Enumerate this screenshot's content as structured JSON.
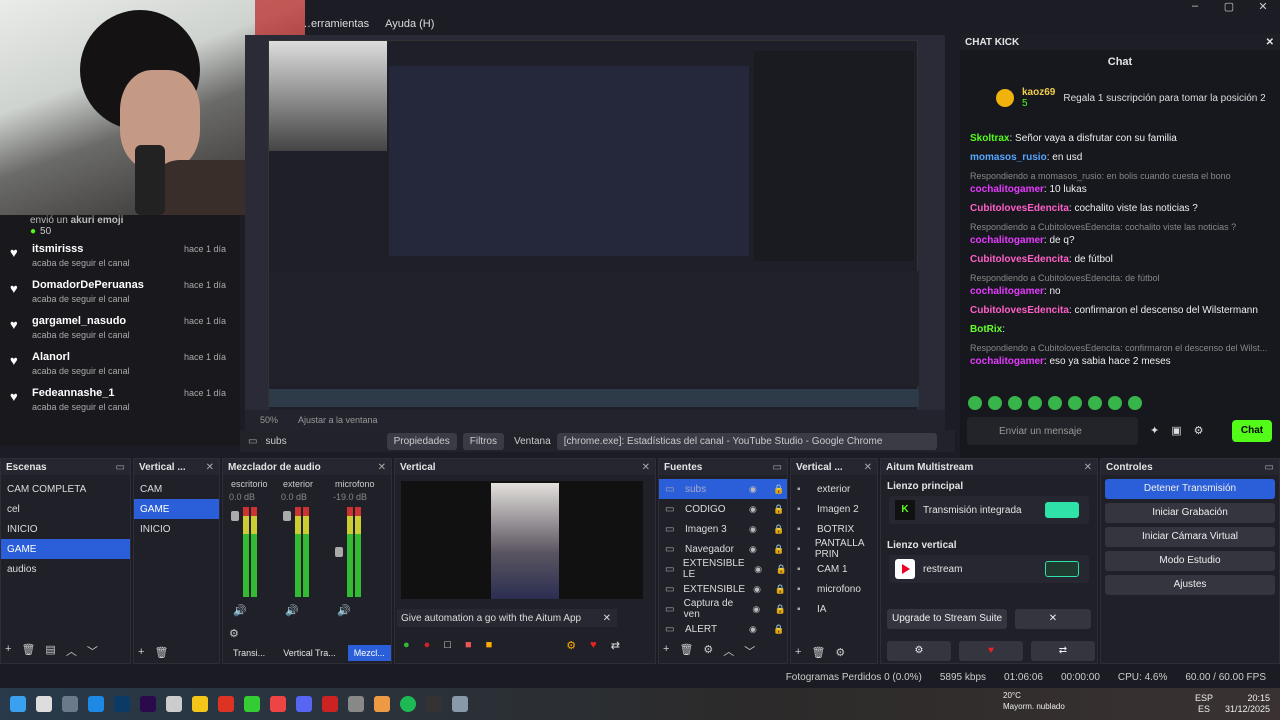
{
  "menu": [
    "…erramientas",
    "Ayuda (H)"
  ],
  "window_controls": [
    "–",
    "▢",
    "✕"
  ],
  "alerts": {
    "first_line": "envió un",
    "first_user": "akuri emoji",
    "points": "50",
    "items": [
      {
        "name": "itsmirisss",
        "action": "acaba de seguir el canal",
        "time": "hace 1 día"
      },
      {
        "name": "DomadorDePeruanas",
        "action": "acaba de seguir el canal",
        "time": "hace 1 día"
      },
      {
        "name": "gargamel_nasudo",
        "action": "acaba de seguir el canal",
        "time": "hace 1 día"
      },
      {
        "name": "Alanorl",
        "action": "acaba de seguir el canal",
        "time": "hace 1 día"
      },
      {
        "name": "Fedeannashe_1",
        "action": "acaba de seguir el canal",
        "time": "hace 1 día"
      }
    ]
  },
  "preview": {
    "zoom": "50%",
    "fit": "Ajustar a la ventana"
  },
  "chat": {
    "dock_title": "CHAT KICK",
    "title": "Chat",
    "pinned_user": "kaoz69",
    "pinned_count": "5",
    "pinned_text": "Regala 1 suscripción para tomar la posición 2",
    "messages": [
      {
        "type": "msg",
        "user": "Skoltrax",
        "ucls": "u1",
        "text": ": Señor vaya a disfrutar con su familia"
      },
      {
        "type": "msg",
        "user": "momasos_rusio",
        "ucls": "u2",
        "text": ": en usd"
      },
      {
        "type": "reply",
        "text": "Respondiendo a momasos_rusio: en bolis cuando cuesta el bono"
      },
      {
        "type": "msg",
        "user": "cochalitogamer",
        "ucls": "u3",
        "text": ": 10 lukas"
      },
      {
        "type": "msg",
        "user": "CubitolovesEdencita",
        "ucls": "u4",
        "text": ": cochalito viste las noticias ?"
      },
      {
        "type": "reply",
        "text": "Respondiendo a CubitolovesEdencita: cochalito viste las noticias ?"
      },
      {
        "type": "msg",
        "user": "cochalitogamer",
        "ucls": "u3",
        "text": ": de q?"
      },
      {
        "type": "msg",
        "user": "CubitolovesEdencita",
        "ucls": "u4",
        "text": ": de fútbol"
      },
      {
        "type": "reply",
        "text": "Respondiendo a CubitolovesEdencita: de fútbol"
      },
      {
        "type": "msg",
        "user": "cochalitogamer",
        "ucls": "u3",
        "text": ": no"
      },
      {
        "type": "msg",
        "user": "CubitolovesEdencita",
        "ucls": "u4",
        "text": ": confirmaron el descenso del Wilstermann"
      },
      {
        "type": "msg",
        "user": "BotRix",
        "ucls": "u5",
        "text": ":"
      },
      {
        "type": "reply",
        "text": "Respondiendo a CubitolovesEdencita: confirmaron el descenso del Wilst..."
      },
      {
        "type": "msg",
        "user": "cochalitogamer",
        "ucls": "u3",
        "text": ": eso ya sabia hace 2 meses"
      }
    ],
    "input_placeholder": "Enviar un mensaje",
    "send": "Chat"
  },
  "toolbar": {
    "source": "subs",
    "props": "Propiedades",
    "filters": "Filtros",
    "window_label": "Ventana",
    "window_value": "[chrome.exe]: Estadísticas del canal - YouTube Studio - Google Chrome"
  },
  "scenes": {
    "title": "Escenas",
    "items": [
      "CAM COMPLETA",
      "cel",
      "INICIO",
      "GAME",
      "audios"
    ],
    "selected": 3
  },
  "vscenes": {
    "title": "Vertical ...",
    "items": [
      "CAM",
      "GAME",
      "INICIO"
    ],
    "selected": 1
  },
  "mixer": {
    "title": "Mezclador de audio",
    "channels": [
      {
        "name": "escritorio",
        "db": "0.0 dB"
      },
      {
        "name": "exterior",
        "db": "0.0 dB"
      },
      {
        "name": "microfono",
        "db": "-19.0 dB"
      }
    ],
    "tabs": [
      "Transi...",
      "Vertical Tra...",
      "Mezcl..."
    ]
  },
  "vertical": {
    "title": "Vertical",
    "banner": "Give automation a go with the Aitum App"
  },
  "sources": {
    "title": "Fuentes",
    "items": [
      "subs",
      "CODIGO",
      "Imagen 3",
      "Navegador",
      "EXTENSIBLE LE",
      "EXTENSIBLE",
      "Captura de ven",
      "ALERT"
    ]
  },
  "vsources": {
    "title": "Vertical ...",
    "items": [
      "exterior",
      "Imagen 2",
      "BOTRIX",
      "PANTALLA PRIN",
      "CAM 1",
      "microfono",
      "IA"
    ]
  },
  "aitum": {
    "title": "Aitum Multistream",
    "main": "Lienzo principal",
    "main_item": "Transmisión integrada",
    "vert": "Lienzo vertical",
    "vert_item": "restream",
    "upgrade": "Upgrade to Stream Suite"
  },
  "controls": {
    "title": "Controles",
    "buttons": [
      "Detener Transmisión",
      "Iniciar Grabación",
      "Iniciar Cámara Virtual",
      "Modo Estudio",
      "Ajustes"
    ]
  },
  "status": {
    "frames": "Fotogramas Perdidos 0 (0.0%)",
    "kbps": "5895 kbps",
    "live": "01:06:06",
    "rec": "00:00:00",
    "cpu": "CPU: 4.6%",
    "fps": "60.00 / 60.00 FPS"
  },
  "taskbar": {
    "temp": "20°C",
    "weather": "Mayorm. nublado",
    "lang": "ESP",
    "lang2": "ES",
    "time": "20:15",
    "date": "31/12/2025"
  },
  "colors": {
    "accent": "#2b5fd9",
    "kick": "#53fc18"
  }
}
